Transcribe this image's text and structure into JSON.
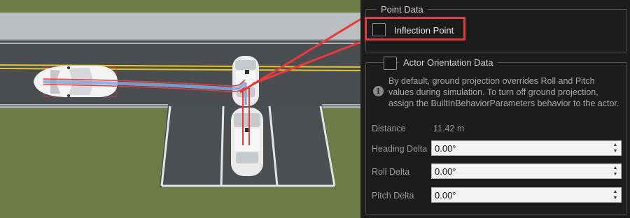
{
  "scene": {
    "description_icon": "road-scene",
    "colors": {
      "grass": "#6c7a44",
      "road": "#4a4d50",
      "curb": "#b9bcbd",
      "lane_yellow": "#e8c636",
      "path_red": "#e8393f",
      "path_blue": "#7fa7d8"
    }
  },
  "panel": {
    "point_data_legend": "Point Data",
    "inflection_point": {
      "label": "Inflection Point",
      "checked": false
    },
    "actor_orientation": {
      "legend": "Actor Orientation Data",
      "checked": false,
      "info_text": "By default, ground projection overrides Roll and Pitch values during simulation. To turn off ground projection, assign the BuiltInBehaviorParameters behavior to the actor.",
      "info_icon": "info-icon"
    },
    "distance": {
      "label": "Distance",
      "value": "11.42 m"
    },
    "heading_delta": {
      "label": "Heading Delta",
      "value": "0.00°"
    },
    "roll_delta": {
      "label": "Roll Delta",
      "value": "0.00°"
    },
    "pitch_delta": {
      "label": "Pitch Delta",
      "value": "0.00°"
    }
  }
}
